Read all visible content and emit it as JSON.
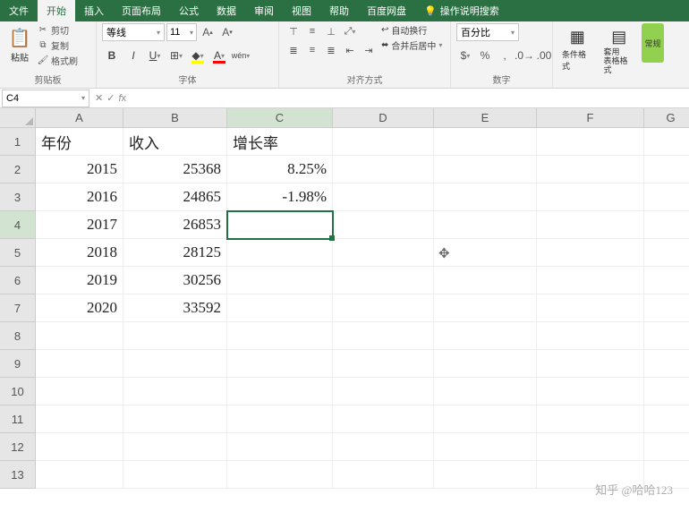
{
  "tabs": {
    "file": "文件",
    "home": "开始",
    "insert": "插入",
    "layout": "页面布局",
    "formulas": "公式",
    "data": "数据",
    "review": "审阅",
    "view": "视图",
    "help": "帮助",
    "baidu": "百度网盘",
    "tell": "操作说明搜索"
  },
  "ribbon": {
    "clipboard": {
      "paste": "粘贴",
      "cut": "剪切",
      "copy": "复制",
      "format_painter": "格式刷",
      "label": "剪贴板"
    },
    "font": {
      "name": "等线",
      "size": "11",
      "label": "字体"
    },
    "alignment": {
      "wrap": "自动换行",
      "merge": "合并后居中",
      "label": "对齐方式"
    },
    "number": {
      "format": "百分比",
      "label": "数字"
    },
    "styles": {
      "cond": "条件格式",
      "table": "套用\n表格格式",
      "constant": "常规"
    }
  },
  "namebox": "C4",
  "formula": "",
  "columns": [
    "A",
    "B",
    "C",
    "D",
    "E",
    "F",
    "G"
  ],
  "row_headers": [
    1,
    2,
    3,
    4,
    5,
    6,
    7,
    8,
    9,
    10,
    11,
    12,
    13
  ],
  "active_cell": {
    "row": 4,
    "col": "C"
  },
  "sheet": {
    "headers": {
      "A": "年份",
      "B": "收入",
      "C": "增长率"
    },
    "rows": [
      {
        "A": "2015",
        "B": "25368",
        "C": "8.25%"
      },
      {
        "A": "2016",
        "B": "24865",
        "C": "-1.98%"
      },
      {
        "A": "2017",
        "B": "26853",
        "C": ""
      },
      {
        "A": "2018",
        "B": "28125",
        "C": ""
      },
      {
        "A": "2019",
        "B": "30256",
        "C": ""
      },
      {
        "A": "2020",
        "B": "33592",
        "C": ""
      }
    ]
  },
  "watermark": "知乎 @哈哈123",
  "chart_data": {
    "type": "table",
    "title": "",
    "columns": [
      "年份",
      "收入",
      "增长率"
    ],
    "rows": [
      [
        "2015",
        25368,
        "8.25%"
      ],
      [
        "2016",
        24865,
        "-1.98%"
      ],
      [
        "2017",
        26853,
        null
      ],
      [
        "2018",
        28125,
        null
      ],
      [
        "2019",
        30256,
        null
      ],
      [
        "2020",
        33592,
        null
      ]
    ]
  }
}
